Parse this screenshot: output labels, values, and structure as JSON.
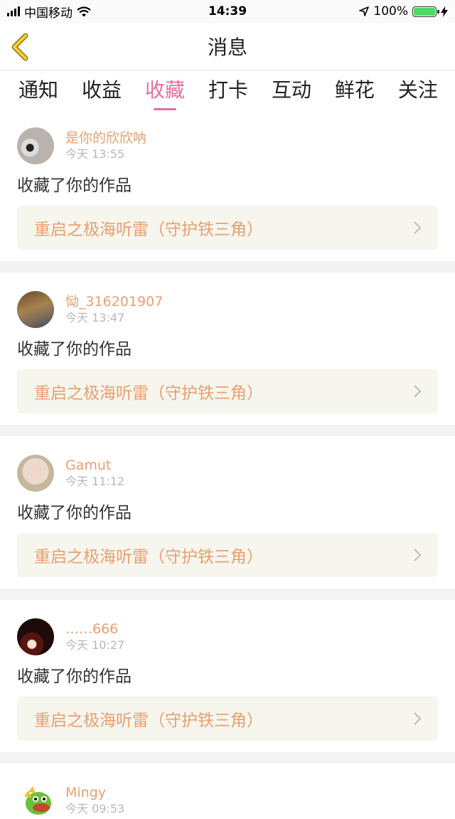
{
  "status_bar": {
    "carrier": "中国移动",
    "time": "14:39",
    "battery": "100%",
    "battery_level": 1.0
  },
  "header": {
    "title": "消息"
  },
  "tabs": [
    {
      "label": "通知"
    },
    {
      "label": "收益"
    },
    {
      "label": "收藏"
    },
    {
      "label": "打卡"
    },
    {
      "label": "互动"
    },
    {
      "label": "鲜花"
    },
    {
      "label": "关注"
    }
  ],
  "active_tab": "收藏",
  "colors": {
    "accent_pink": "#e76fa0",
    "name_orange": "#e8a070",
    "work_box_bg": "#f6f5ee"
  },
  "messages": [
    {
      "name": "是你的欣欣呐",
      "time": "今天 13:55",
      "action": "收藏了你的作品",
      "work": "重启之极海听雷（守护铁三角）"
    },
    {
      "name": "恸_316201907",
      "time": "今天 13:47",
      "action": "收藏了你的作品",
      "work": "重启之极海听雷（守护铁三角）"
    },
    {
      "name": "Gamut",
      "time": "今天 11:12",
      "action": "收藏了你的作品",
      "work": "重启之极海听雷（守护铁三角）"
    },
    {
      "name": "……666",
      "time": "今天 10:27",
      "action": "收藏了你的作品",
      "work": "重启之极海听雷（守护铁三角）"
    },
    {
      "name": "Mingy",
      "time": "今天 09:53"
    }
  ]
}
